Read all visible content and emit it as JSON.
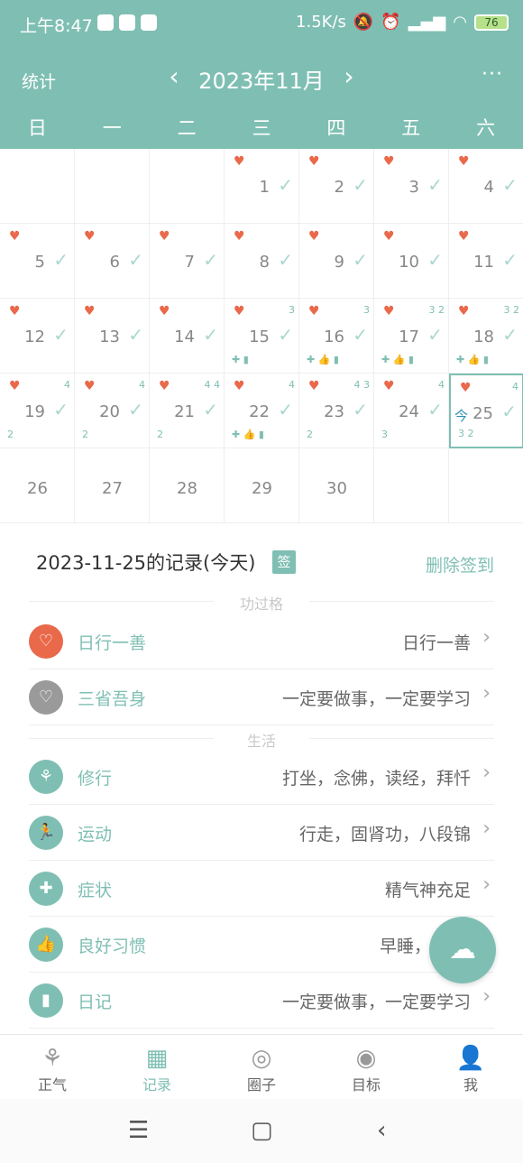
{
  "status": {
    "time": "上午8:47",
    "speed": "1.5K/s",
    "battery": "76"
  },
  "header": {
    "stats": "统计",
    "month": "2023年11月",
    "prev": "‹",
    "next": "›",
    "more": "···"
  },
  "weekdays": [
    "日",
    "一",
    "二",
    "三",
    "四",
    "五",
    "六"
  ],
  "calendar": {
    "today_tag": "今",
    "check": "✓",
    "heart": "♥",
    "days": {
      "d1": "1",
      "d2": "2",
      "d3": "3",
      "d4": "4",
      "d5": "5",
      "d6": "6",
      "d7": "7",
      "d8": "8",
      "d9": "9",
      "d10": "10",
      "d11": "11",
      "d12": "12",
      "d13": "13",
      "d14": "14",
      "d15": "15",
      "d16": "16",
      "d17": "17",
      "d18": "18",
      "d19": "19",
      "d20": "20",
      "d21": "21",
      "d22": "22",
      "d23": "23",
      "d24": "24",
      "d25": "25",
      "d26": "26",
      "d27": "27",
      "d28": "28",
      "d29": "29",
      "d30": "30"
    },
    "badges": {
      "t15": "3",
      "t16": "3",
      "t17": "3 2",
      "t18": "3 2",
      "t19": "4",
      "t20": "4",
      "t21": "4 4",
      "t22": "4",
      "t23": "4 3",
      "t24": "4",
      "t25": "4",
      "b16": "",
      "b17": "",
      "b18": "",
      "b19": "2",
      "b20": "2",
      "b21": "2",
      "b22": "",
      "b23": "2",
      "b24": "3",
      "b25": "3 2"
    }
  },
  "record": {
    "title": "2023-11-25的记录(今天)",
    "sign": "签",
    "delete": "删除签到",
    "section1": "功过格",
    "section2": "生活",
    "rows": [
      {
        "label": "日行一善",
        "value": "日行一善"
      },
      {
        "label": "三省吾身",
        "value": "一定要做事，一定要学习"
      },
      {
        "label": "修行",
        "value": "打坐，念佛，读经，拜忏"
      },
      {
        "label": "运动",
        "value": "行走，固肾功，八段锦"
      },
      {
        "label": "症状",
        "value": "精气神充足"
      },
      {
        "label": "良好习惯",
        "value": "早睡，"
      },
      {
        "label": "日记",
        "value": "一定要做事，一定要学习"
      }
    ]
  },
  "nav": [
    {
      "label": "正气"
    },
    {
      "label": "记录"
    },
    {
      "label": "圈子"
    },
    {
      "label": "目标"
    },
    {
      "label": "我"
    }
  ],
  "colors": {
    "accent": "#7fbfb3",
    "heart": "#e9694a",
    "gray_icon": "#9a9a9a"
  }
}
